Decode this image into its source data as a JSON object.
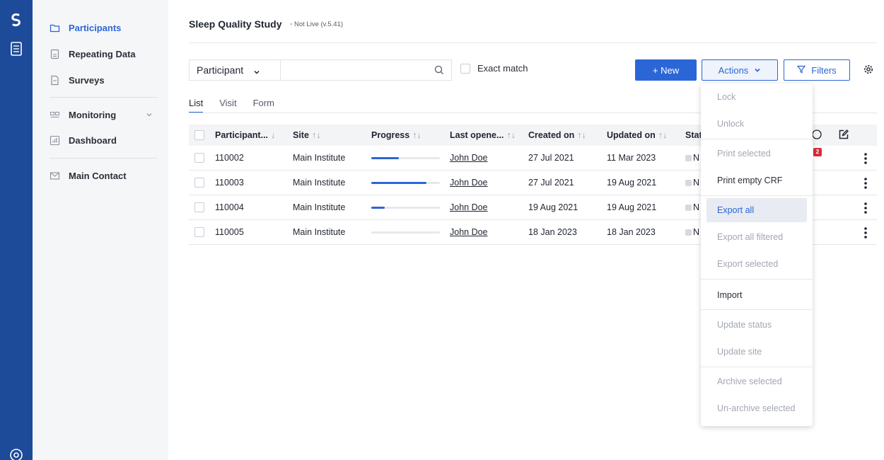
{
  "rail": {
    "logo_glyph": "ɡ",
    "icons": [
      "logo-icon",
      "list-icon",
      "help-icon"
    ]
  },
  "sidebar": {
    "items": [
      {
        "label": "Participants",
        "icon": "folder-icon",
        "active": true
      },
      {
        "label": "Repeating Data",
        "icon": "document-icon"
      },
      {
        "label": "Surveys",
        "icon": "survey-icon"
      },
      {
        "label": "Monitoring",
        "icon": "monitoring-icon",
        "expandable": true
      },
      {
        "label": "Dashboard",
        "icon": "chart-icon"
      },
      {
        "label": "Main Contact",
        "icon": "mail-icon"
      }
    ]
  },
  "header": {
    "study_title": "Sleep Quality Study",
    "study_status": "◦ Not Live (v.5.41)"
  },
  "search": {
    "field_select": "Participant",
    "query": "",
    "placeholder": "",
    "exact_match_label": "Exact match"
  },
  "toolbar": {
    "new_label": "+  New",
    "actions_label": "Actions",
    "filters_label": "Filters"
  },
  "tabs": [
    {
      "label": "List",
      "active": true
    },
    {
      "label": "Visit"
    },
    {
      "label": "Form"
    }
  ],
  "table": {
    "columns": [
      {
        "label": "Participant...",
        "sort": "↓"
      },
      {
        "label": "Site",
        "sort": "↑↓"
      },
      {
        "label": "Progress",
        "sort": "↑↓"
      },
      {
        "label": "Last opene...",
        "sort": "↑↓"
      },
      {
        "label": "Created on",
        "sort": "↑↓"
      },
      {
        "label": "Updated on",
        "sort": "↑↓"
      },
      {
        "label": "Stat",
        "sort": ""
      }
    ],
    "notification_count": "2",
    "rows": [
      {
        "id": "110002",
        "site": "Main Institute",
        "progress": 0.4,
        "last_opened": "John Doe",
        "created": "27 Jul 2021",
        "updated": "11 Mar 2023",
        "status": "N"
      },
      {
        "id": "110003",
        "site": "Main Institute",
        "progress": 0.8,
        "last_opened": "John Doe",
        "created": "27 Jul 2021",
        "updated": "19 Aug 2021",
        "status": "N"
      },
      {
        "id": "110004",
        "site": "Main Institute",
        "progress": 0.2,
        "last_opened": "John Doe",
        "created": "19 Aug 2021",
        "updated": "19 Aug 2021",
        "status": "N"
      },
      {
        "id": "110005",
        "site": "Main Institute",
        "progress": 0.0,
        "last_opened": "John Doe",
        "created": "18 Jan 2023",
        "updated": "18 Jan 2023",
        "status": "N"
      }
    ]
  },
  "actions_menu": {
    "items": [
      {
        "label": "Lock",
        "enabled": false
      },
      {
        "label": "Unlock",
        "enabled": false
      },
      {
        "label": "Print selected",
        "enabled": false
      },
      {
        "label": "Print empty CRF",
        "enabled": true
      },
      {
        "label": "Export all",
        "enabled": true,
        "highlighted": true
      },
      {
        "label": "Export all filtered",
        "enabled": false
      },
      {
        "label": "Export selected",
        "enabled": false
      },
      {
        "label": "Import",
        "enabled": true
      },
      {
        "label": "Update status",
        "enabled": false
      },
      {
        "label": "Update site",
        "enabled": false
      },
      {
        "label": "Archive selected",
        "enabled": false
      },
      {
        "label": "Un-archive selected",
        "enabled": false
      }
    ]
  },
  "colors": {
    "rail": "#1d4b9a",
    "accent": "#2b66d6",
    "badge": "#d92d3a"
  }
}
